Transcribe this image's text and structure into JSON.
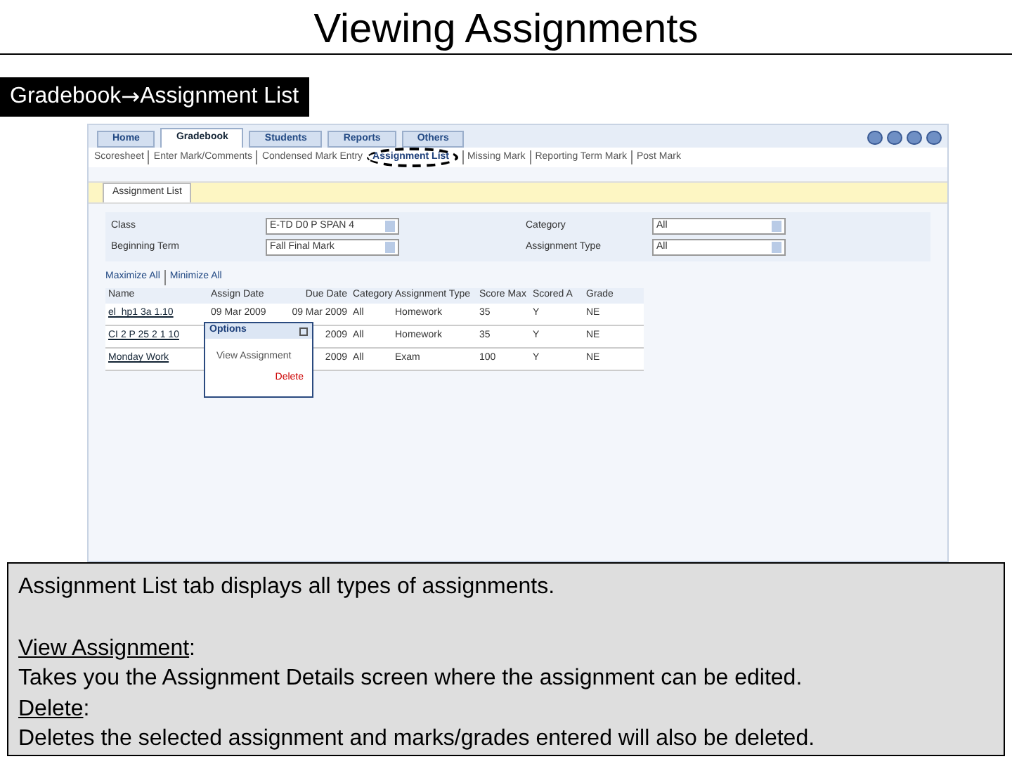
{
  "slide_title": "Viewing Assignments",
  "breadcrumb": {
    "from": "Gradebook",
    "arrow": "→",
    "to": "Assignment List"
  },
  "app": {
    "tabs": [
      {
        "label": "Home",
        "selected": false
      },
      {
        "label": "Gradebook",
        "selected": true
      },
      {
        "label": "Students",
        "selected": false
      },
      {
        "label": "Reports",
        "selected": false
      },
      {
        "label": "Others",
        "selected": false
      }
    ],
    "subnav": [
      {
        "label": "Scoresheet",
        "selected": false
      },
      {
        "label": "Enter Mark/Comments",
        "selected": false
      },
      {
        "label": "Condensed Mark Entry",
        "selected": false
      },
      {
        "label": "Assignment List",
        "selected": true
      },
      {
        "label": "Missing Mark",
        "selected": false
      },
      {
        "label": "Reporting Term Mark",
        "selected": false
      },
      {
        "label": "Post Mark",
        "selected": false
      }
    ],
    "page_tab": "Assignment List",
    "filters": [
      {
        "label": "Class",
        "value": "E-TD D0 P SPAN 4"
      },
      {
        "label": "Category",
        "value": "All"
      },
      {
        "label": "Beginning Term",
        "value": "Fall Final Mark"
      },
      {
        "label": "Assignment Type",
        "value": "All"
      }
    ],
    "expand_links": [
      "Maximize All",
      "Minimize All"
    ],
    "table": {
      "columns": [
        "Name",
        "Assign Date",
        "Due Date",
        "Category",
        "Assignment Type",
        "Score Max",
        "Scored A",
        "Grade"
      ],
      "rows": [
        {
          "cells": [
            "el_hp1 3a 1.10",
            "09 Mar 2009",
            "09 Mar 2009",
            "All",
            "Homework",
            "35",
            "Y",
            "NE"
          ]
        },
        {
          "cells": [
            "CI 2 P 25 2 1 10",
            "",
            "2009",
            "All",
            "Homework",
            "35",
            "Y",
            "NE"
          ]
        },
        {
          "cells": [
            "Monday Work",
            "",
            "2009",
            "All",
            "Exam",
            "100",
            "Y",
            "NE"
          ]
        }
      ]
    },
    "popup": {
      "title": "Options",
      "items": [
        {
          "label": "View Assignment",
          "kind": "normal"
        },
        {
          "label": "Delete",
          "kind": "danger"
        }
      ]
    }
  },
  "caption": {
    "intro": "Assignment List tab displays all types of assignments.",
    "items": [
      {
        "term": "View Assignment",
        "separator": ":",
        "description": "Takes you the Assignment Details screen where the assignment can be edited."
      },
      {
        "term": "Delete",
        "separator": ":",
        "description": "Deletes the selected assignment and marks/grades entered will also be deleted."
      }
    ]
  }
}
